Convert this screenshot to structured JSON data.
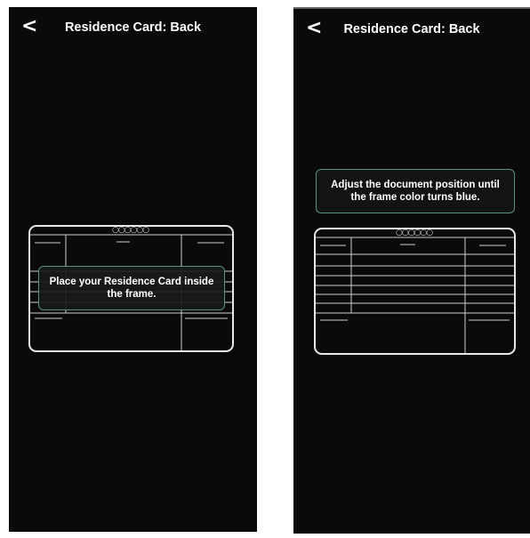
{
  "screens": [
    {
      "back_icon": "chevron-left-icon",
      "back_glyph": "<",
      "title": "Residence Card: Back",
      "card_dots": "○○○○○○",
      "message": "Place your Residence Card inside the frame."
    },
    {
      "back_icon": "chevron-left-icon",
      "back_glyph": "<",
      "title": "Residence Card: Back",
      "card_dots": "○○○○○○",
      "message": "Adjust the document position until the frame color turns blue."
    }
  ],
  "colors": {
    "screen_bg": "#0a0a0a",
    "frame": "#e8e8e8",
    "message_border": "#5c8f86"
  }
}
